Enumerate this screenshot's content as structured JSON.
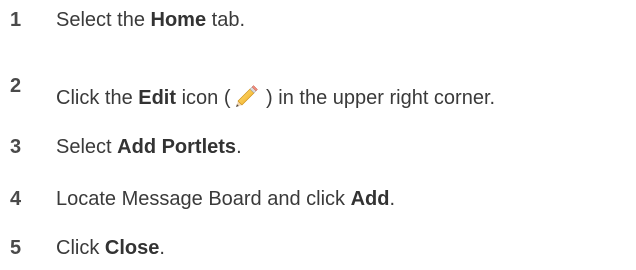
{
  "steps": [
    {
      "number": "1",
      "before": "Select the ",
      "bold": "Home",
      "after": " tab."
    },
    {
      "number": "2",
      "before": "Click the ",
      "bold": "Edit",
      "middle": " icon (",
      "icon": "pencil-icon",
      "after": " ) in the upper right corner."
    },
    {
      "number": "3",
      "before": "Select ",
      "bold": "Add Portlets",
      "after": "."
    },
    {
      "number": "4",
      "before": "Locate Message Board and click ",
      "bold": "Add",
      "after": "."
    },
    {
      "number": "5",
      "before": "Click ",
      "bold": "Close",
      "after": "."
    }
  ]
}
